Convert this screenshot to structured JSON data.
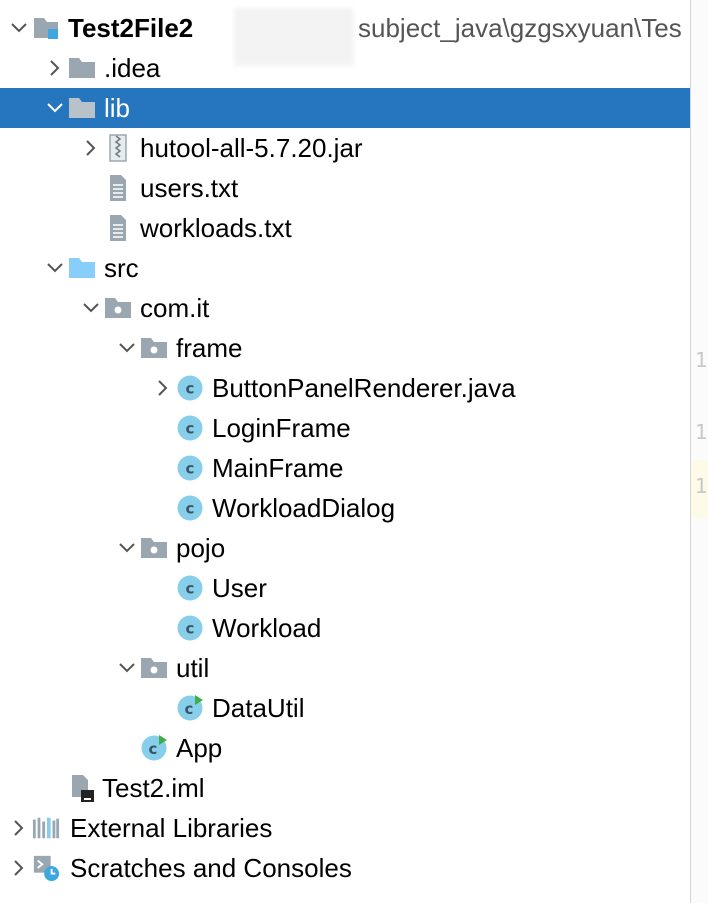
{
  "tree": {
    "rows": [
      {
        "key": "root",
        "label": "Test2File2",
        "path": "subject_java\\gzgsxyuan\\Tes",
        "bold": true,
        "chevron": "down",
        "icon": "project-module-icon"
      },
      {
        "key": "idea",
        "label": ".idea",
        "chevron": "right",
        "icon": "folder-icon"
      },
      {
        "key": "lib",
        "label": "lib",
        "chevron": "down",
        "icon": "folder-icon",
        "selected": true
      },
      {
        "key": "hutool",
        "label": "hutool-all-5.7.20.jar",
        "chevron": "right",
        "icon": "jar-archive-icon"
      },
      {
        "key": "users_txt",
        "label": "users.txt",
        "icon": "text-file-icon"
      },
      {
        "key": "workloads_txt",
        "label": "workloads.txt",
        "icon": "text-file-icon"
      },
      {
        "key": "src",
        "label": "src",
        "chevron": "down",
        "icon": "source-root-folder-icon"
      },
      {
        "key": "com_it",
        "label": "com.it",
        "chevron": "down",
        "icon": "package-icon"
      },
      {
        "key": "frame",
        "label": "frame",
        "chevron": "down",
        "icon": "package-icon"
      },
      {
        "key": "button_panel",
        "label": "ButtonPanelRenderer.java",
        "chevron": "right",
        "icon": "java-class-icon"
      },
      {
        "key": "login_frame",
        "label": "LoginFrame",
        "icon": "java-class-icon"
      },
      {
        "key": "main_frame",
        "label": "MainFrame",
        "icon": "java-class-icon"
      },
      {
        "key": "workload_dialog",
        "label": "WorkloadDialog",
        "icon": "java-class-icon"
      },
      {
        "key": "pojo",
        "label": "pojo",
        "chevron": "down",
        "icon": "package-icon"
      },
      {
        "key": "user",
        "label": "User",
        "icon": "java-class-icon"
      },
      {
        "key": "workload",
        "label": "Workload",
        "icon": "java-class-icon"
      },
      {
        "key": "util",
        "label": "util",
        "chevron": "down",
        "icon": "package-icon"
      },
      {
        "key": "data_util",
        "label": "DataUtil",
        "icon": "java-runnable-class-icon"
      },
      {
        "key": "app",
        "label": "App",
        "icon": "java-runnable-class-icon"
      },
      {
        "key": "iml",
        "label": "Test2.iml",
        "icon": "iml-file-icon"
      },
      {
        "key": "ext_libs",
        "label": "External Libraries",
        "chevron": "right",
        "icon": "libraries-icon"
      },
      {
        "key": "scratches",
        "label": "Scratches and Consoles",
        "chevron": "right",
        "icon": "scratches-icon"
      }
    ]
  },
  "colors": {
    "selection": "#2675bf",
    "folder": "#9aa7b0",
    "source_folder": "#87cefa",
    "class_circle": "#87ceeb",
    "class_letter": "#3a5563",
    "run_arrow": "#3fae49"
  }
}
